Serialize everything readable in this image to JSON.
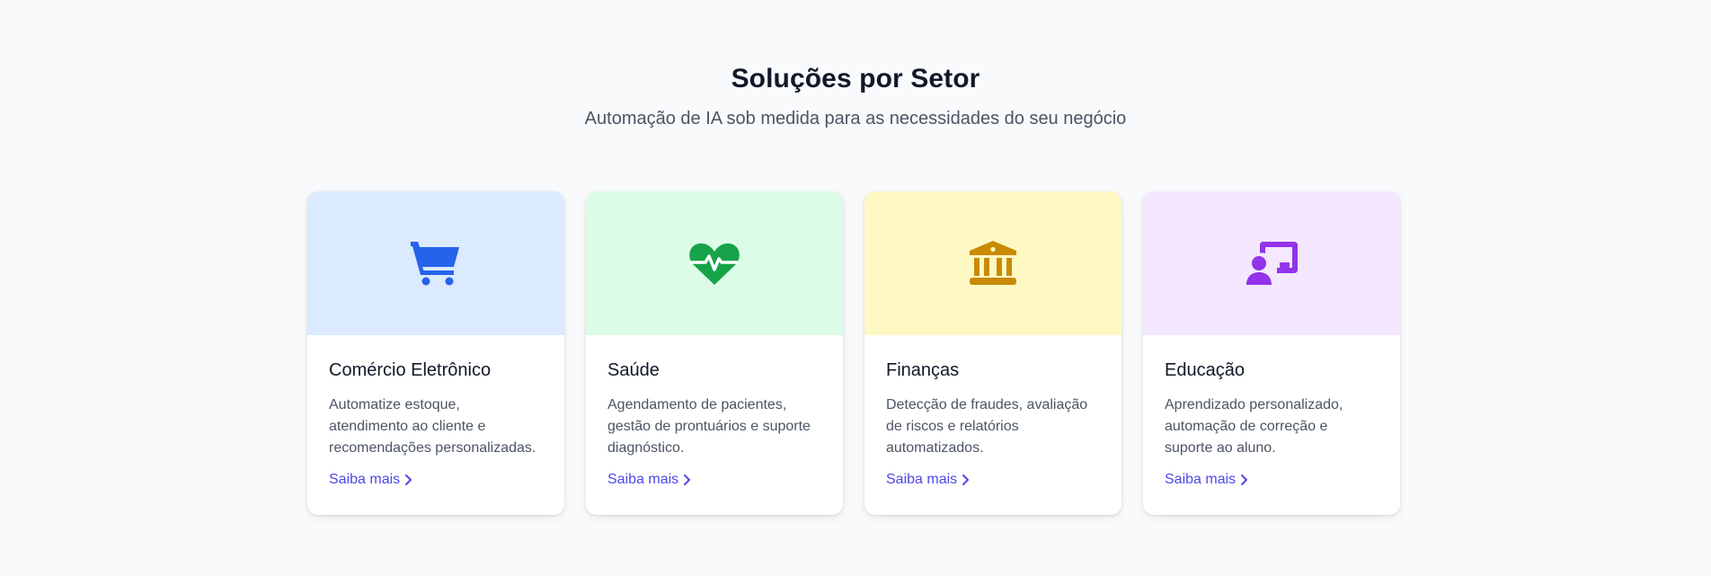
{
  "section": {
    "title": "Soluções por Setor",
    "subtitle": "Automação de IA sob medida para as necessidades do seu negócio"
  },
  "cards": [
    {
      "title": "Comércio Eletrônico",
      "description": "Automatize estoque, atendimento ao cliente e recomendações personalizadas.",
      "link": "Saiba mais",
      "icon": "shopping-cart-icon",
      "bg_color": "#dbeafe",
      "icon_color": "#2563eb"
    },
    {
      "title": "Saúde",
      "description": "Agendamento de pacientes, gestão de prontuários e suporte diagnóstico.",
      "link": "Saiba mais",
      "icon": "heart-pulse-icon",
      "bg_color": "#dcfce7",
      "icon_color": "#16a34a"
    },
    {
      "title": "Finanças",
      "description": "Detecção de fraudes, avaliação de riscos e relatórios automatizados.",
      "link": "Saiba mais",
      "icon": "bank-icon",
      "bg_color": "#fef9c3",
      "icon_color": "#ca8a04"
    },
    {
      "title": "Educação",
      "description": "Aprendizado personalizado, automação de correção e suporte ao aluno.",
      "link": "Saiba mais",
      "icon": "teacher-board-icon",
      "bg_color": "#f3e8ff",
      "icon_color": "#9333ea"
    }
  ],
  "colors": {
    "page_bg": "#f8fafc",
    "link": "#4f46e5",
    "heading": "#111827",
    "body_text": "#4b5563"
  }
}
